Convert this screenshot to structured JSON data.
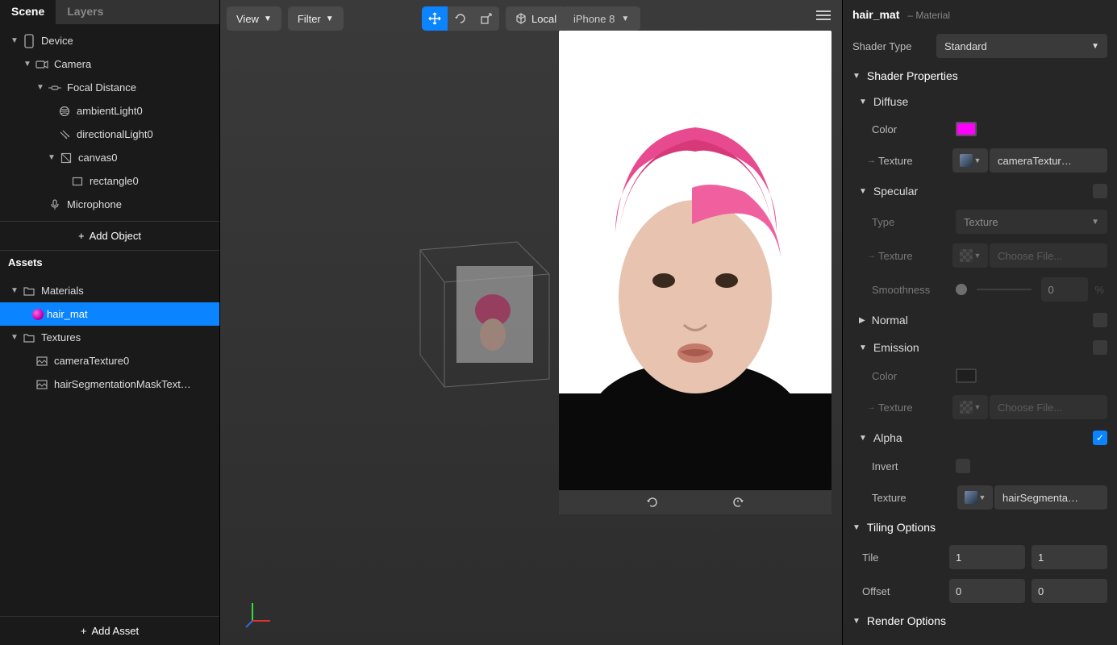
{
  "tabs": {
    "scene": "Scene",
    "layers": "Layers"
  },
  "scene_tree": {
    "device": "Device",
    "camera": "Camera",
    "focal": "Focal Distance",
    "ambient": "ambientLight0",
    "directional": "directionalLight0",
    "canvas": "canvas0",
    "rectangle": "rectangle0",
    "microphone": "Microphone"
  },
  "add_object": "Add Object",
  "assets_header": "Assets",
  "assets": {
    "materials": "Materials",
    "hair_mat": "hair_mat",
    "textures": "Textures",
    "cameraTexture": "cameraTexture0",
    "hairSeg": "hairSegmentationMaskText…"
  },
  "add_asset": "Add Asset",
  "toolbar": {
    "view": "View",
    "filter": "Filter",
    "local": "Local",
    "device": "iPhone 8"
  },
  "inspector": {
    "title": "hair_mat",
    "subtitle": "– Material",
    "shader_type_label": "Shader Type",
    "shader_type_value": "Standard",
    "shader_props": "Shader Properties",
    "diffuse": "Diffuse",
    "color_label": "Color",
    "diffuse_color": "#ff00ff",
    "texture_label": "Texture",
    "diffuse_texture": "cameraTextur…",
    "specular": "Specular",
    "type_label": "Type",
    "specular_type": "Texture",
    "choose_file": "Choose File...",
    "smoothness_label": "Smoothness",
    "smoothness_value": "0",
    "normal": "Normal",
    "emission": "Emission",
    "emission_color": "#1a1a1a",
    "alpha": "Alpha",
    "invert_label": "Invert",
    "alpha_texture": "hairSegmenta…",
    "tiling": "Tiling Options",
    "tile_label": "Tile",
    "tile_x": "1",
    "tile_y": "1",
    "offset_label": "Offset",
    "offset_x": "0",
    "offset_y": "0",
    "render_options": "Render Options"
  }
}
